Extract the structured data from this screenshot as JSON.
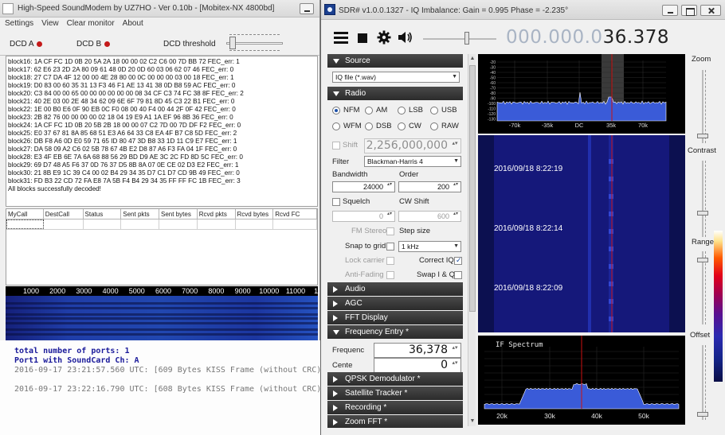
{
  "terminal": {
    "line_partial": "total number of ports: 1",
    "line_port": "Port1 with SoundCard Ch: A",
    "line1": "2016-09-17 23:21:57.560 UTC: [609 Bytes KISS Frame (without CRC)",
    "line2": "2016-09-17 23:22:16.790 UTC: [608 Bytes KISS Frame (without CRC)"
  },
  "soundmodem": {
    "title": "High-Speed SoundModem by UZ7HO - Ver 0.10b - [Mobitex-NX 4800bd]",
    "menu": [
      "Settings",
      "View",
      "Clear monitor",
      "About"
    ],
    "dcd_a": "DCD A",
    "dcd_b": "DCD B",
    "dcd_threshold": "DCD threshold",
    "led_color": "#c41a1a",
    "log": [
      "block16: 1A CF FC 1D 0B 20 5A 2A 18 00 00 02 C2 C6 00 7D BB 72  FEC_err: 1",
      "block17: 62 E6 23 2D 2A 80 09 61 48 0D 20 0D 60 03 06 62 07 46  FEC_err: 0",
      "block18: 27 C7 DA 4F 12 00 00 4E 28 80 00 0C 00 00 00 03 00 18  FEC_err: 1",
      "block19: D0 83 00 60 35 31 13 F3 46 F1 AE 13 41 38 0D B8 59 AC  FEC_err: 0",
      "block20: C3 84 00 00 65 00 00 00 00 00 00 08 34 CF C3 74 FC 38 8F  FEC_err: 2",
      "block21: 40 2E 03 00 2E 48 34 62 09 6E 6F 79 81 8D 45 C3 22 B1  FEC_err: 0",
      "block22: 1E 00 B0 E6 0F 90 EB 0C F0 08 00 40 F4 00 44 2F 0F 42  FEC_err: 0",
      "block23: 2B 82 76 00 00 00 00 02 18 04 19 E9 A1 1A EF 96 8B 36  FEC_err: 0",
      "block24: 1A CF FC 1D 0B 20 5B 2B 18 00 00 07 C2 7D 00 7D DF F2  FEC_err: 0",
      "block25: E0 37 67 81 8A 85 68 51 E3 A6 64 33 C8 EA 4F B7 C8 5D  FEC_err: 2",
      "block26: DB F8 A6 0D E0 59 71 65 ID 80 47 3D B8 33 1D 11 C9 E7  FEC_err: 1",
      "block27: DA 58 09 A2 C6 02 5B 78 67 4B E2 D8 87 A6 F3 FA 04 1F  FEC_err: 0",
      "block28: E3 4F EB 6E 7A 6A 68 88 56 29 BD D9 AE 3C 2C FD 8D 5C  FEC_err: 0",
      "block29: 69 D7 48 A5 F6 37 0D 76 37 D5 8B 8A 07 0E CE 02 D3 E2  FEC_err: 1",
      "block30: 21 8B E9 1C 39 C4 00 02 B4 29 34 35 D7 C1 D7 CD 9B 49  FEC_err: 0",
      "block31: FD B3 22 CD 72 FA E8 7A 5B F4 B4 29 34 35 FF FF FC 1B  FEC_err: 3",
      "All blocks successfully decoded!"
    ],
    "ports_headers": [
      "MyCall",
      "DestCall",
      "Status",
      "Sent pkts",
      "Sent bytes",
      "Rcvd pkts",
      "Rcvd bytes",
      "Rcvd FC"
    ],
    "wf_scale": [
      "1000",
      "2000",
      "3000",
      "4000",
      "5000",
      "6000",
      "7000",
      "8000",
      "9000",
      "10000",
      "11000",
      "1200"
    ]
  },
  "sdr": {
    "title": "SDR# v1.0.0.1327 - IQ Imbalance: Gain = 0.995 Phase = -2.235°",
    "freq_dim": "000.000.0",
    "freq_bright": "36.378",
    "sections": {
      "source": "Source",
      "radio": "Radio",
      "audio": "Audio",
      "agc": "AGC",
      "fft": "FFT Display",
      "freq_entry": "Frequency Entry *",
      "qpsk": "QPSK Demodulator *",
      "satellite": "Satellite Tracker *",
      "recording": "Recording *",
      "zoomfft": "Zoom FFT *"
    },
    "source_combo": "IQ file (*.wav)",
    "modes": [
      "NFM",
      "AM",
      "LSB",
      "USB",
      "WFM",
      "DSB",
      "CW",
      "RAW"
    ],
    "selected_mode": "NFM",
    "shift_label": "Shift",
    "shift_value": "2,256,000,000",
    "filter_label": "Filter",
    "filter_value": "Blackman-Harris 4",
    "bandwidth_label": "Bandwidth",
    "bandwidth_value": "24000",
    "order_label": "Order",
    "order_value": "200",
    "squelch_label": "Squelch",
    "cwshift_label": "CW Shift",
    "squelch_value": "0",
    "cwshift_value": "600",
    "fmstereo_label": "FM Stereo",
    "stepsize_label": "Step size",
    "snap_label": "Snap to grid",
    "step_value": "1 kHz",
    "lockcarrier_label": "Lock carrier",
    "correctiq_label": "Correct IQ",
    "antifading_label": "Anti-Fading",
    "swapiq_label": "Swap I & Q",
    "freq_entry_label": "Frequenc",
    "freq_entry_value": "36,378",
    "center_label": "Cente",
    "center_value": "0",
    "spectrum_db": [
      "-20",
      "-30",
      "-40",
      "-50",
      "-60",
      "-70",
      "-80",
      "-90",
      "-100",
      "-110",
      "-120",
      "-130"
    ],
    "spectrum_freqs": [
      "-70k",
      "-35k",
      "DC",
      "35k",
      "70k"
    ],
    "waterfall_times": [
      "2016/09/18 8:22:19",
      "2016/09/18 8:22:14",
      "2016/09/18 8:22:09"
    ],
    "if_title": "IF Spectrum",
    "if_freqs": [
      "20k",
      "30k",
      "40k",
      "50k"
    ],
    "zoom_label": "Zoom",
    "contrast_label": "Contrast",
    "range_label": "Range",
    "offset_label": "Offset",
    "accent_red": "#cc1111",
    "spectrum_fill": "#3a5bd8"
  }
}
